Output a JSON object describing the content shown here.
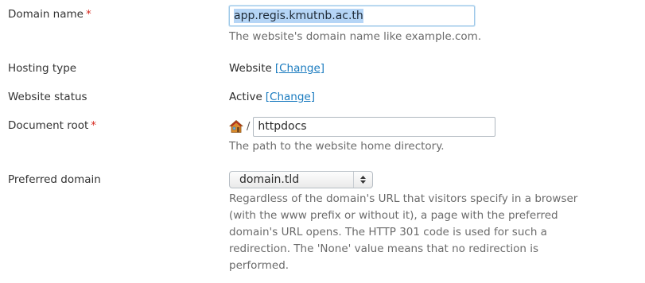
{
  "form": {
    "domain_name": {
      "label": "Domain name",
      "required_mark": "*",
      "value": "app.regis.kmutnb.ac.th",
      "hint": "The website's domain name like example.com."
    },
    "hosting_type": {
      "label": "Hosting type",
      "value": "Website",
      "change_link": "[Change]"
    },
    "website_status": {
      "label": "Website status",
      "value": "Active",
      "change_link": "[Change]"
    },
    "document_root": {
      "label": "Document root",
      "required_mark": "*",
      "icon": "home-icon",
      "separator": "/",
      "value": "httpdocs",
      "hint": "The path to the website home directory."
    },
    "preferred_domain": {
      "label": "Preferred domain",
      "selected": "domain.tld",
      "hint_lines": [
        "Regardless of the domain's URL that visitors specify in a browser",
        "(with the www prefix or without it), a page with the preferred",
        "domain's URL opens. The HTTP 301 code is used for such a",
        "redirection. The 'None' value means that no redirection is",
        "performed."
      ]
    }
  },
  "colors": {
    "link": "#1a7bbf",
    "required": "#d6281f",
    "hint": "#6b6b6b",
    "selection": "#b5d5f6"
  }
}
